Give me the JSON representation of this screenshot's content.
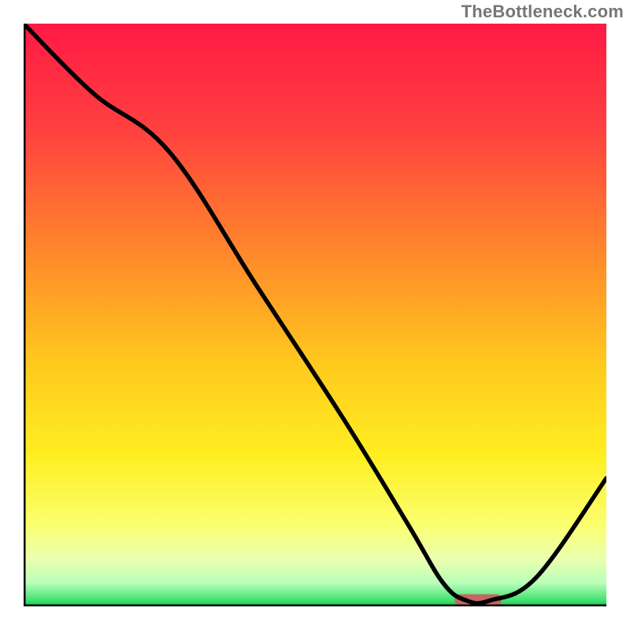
{
  "watermark": "TheBottleneck.com",
  "chart_data": {
    "type": "line",
    "title": "",
    "xlabel": "",
    "ylabel": "",
    "xlim": [
      0,
      100
    ],
    "ylim": [
      0,
      100
    ],
    "x": [
      0,
      12,
      25,
      40,
      55,
      66,
      72,
      76,
      80,
      88,
      100
    ],
    "values": [
      100,
      88,
      78,
      55,
      32,
      14,
      4,
      1,
      1,
      5,
      22
    ],
    "marker": {
      "x_start": 74,
      "x_end": 82,
      "y": 1
    },
    "gradient_stops": [
      {
        "pct": 0,
        "color": "#ff1a44"
      },
      {
        "pct": 18,
        "color": "#ff4040"
      },
      {
        "pct": 40,
        "color": "#ff8a2a"
      },
      {
        "pct": 58,
        "color": "#ffc81e"
      },
      {
        "pct": 74,
        "color": "#ffee20"
      },
      {
        "pct": 86,
        "color": "#fbff70"
      },
      {
        "pct": 92,
        "color": "#eaffb0"
      },
      {
        "pct": 96,
        "color": "#b8ffb8"
      },
      {
        "pct": 99,
        "color": "#40e070"
      },
      {
        "pct": 100,
        "color": "#15c455"
      }
    ]
  }
}
